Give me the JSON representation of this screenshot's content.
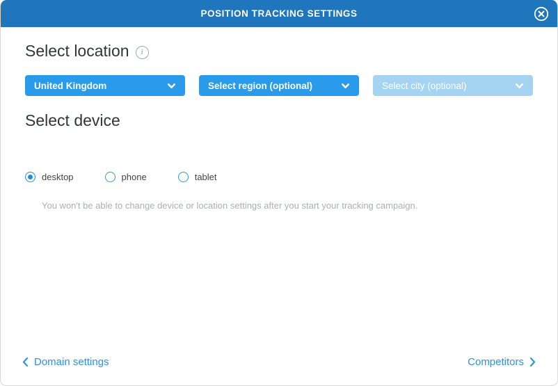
{
  "titlebar": {
    "title": "POSITION TRACKING SETTINGS",
    "close_icon": "close-circle-icon",
    "background": "#1f76bd"
  },
  "location_section": {
    "heading": "Select location",
    "info_icon": "info-icon",
    "dropdowns": [
      {
        "value": "United Kingdom",
        "state": "enabled",
        "icon": "chevron-down-icon",
        "color": "#2a9bea"
      },
      {
        "value": "Select region (optional)",
        "state": "enabled",
        "icon": "chevron-down-icon",
        "color": "#2a9bea"
      },
      {
        "value": "Select city (optional)",
        "state": "disabled",
        "icon": "chevron-down-icon",
        "color": "#a5d4f2"
      }
    ]
  },
  "device_section": {
    "heading": "Select device",
    "options": [
      {
        "label": "desktop",
        "selected": true
      },
      {
        "label": "phone",
        "selected": false
      },
      {
        "label": "tablet",
        "selected": false
      }
    ],
    "helper_text": "You won't be able to change device or location settings after you start your tracking campaign."
  },
  "footer": {
    "back_label": "Domain settings",
    "back_icon": "chevron-left-icon",
    "next_label": "Competitors",
    "next_icon": "chevron-right-icon",
    "link_color": "#2f8fe0"
  }
}
